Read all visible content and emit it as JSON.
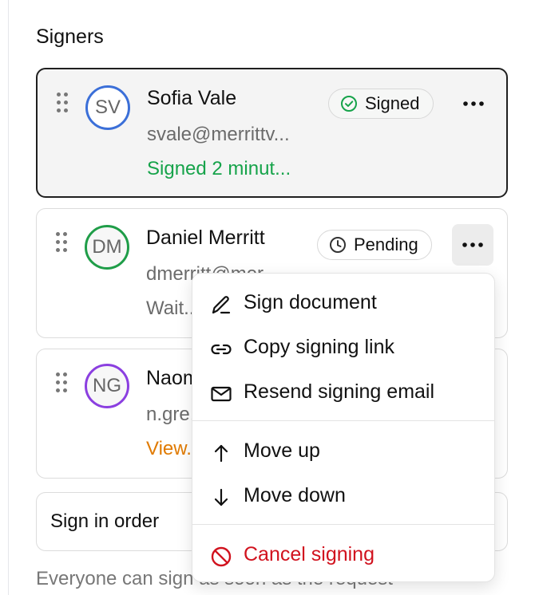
{
  "section_title": "Signers",
  "signers": [
    {
      "initials": "SV",
      "name": "Sofia Vale",
      "email": "svale@merrittv...",
      "status_text": "Signed 2 minut...",
      "badge": "Signed",
      "avatar_color": "#3b6fd8",
      "status_color": "#16a34a"
    },
    {
      "initials": "DM",
      "name": "Daniel Merritt",
      "email": "dmerritt@mer...",
      "status_text": "Wait...",
      "badge": "Pending",
      "avatar_color": "#1f9d48",
      "status_color": "#6b6b6b"
    },
    {
      "initials": "NG",
      "name": "Naomi...",
      "email": "n.gre...",
      "status_text": "View...",
      "avatar_color": "#8b3fe0",
      "status_color": "#e07a00"
    }
  ],
  "order_label": "Sign in order",
  "helper_text": "Everyone can sign as soon as the request",
  "menu": {
    "items": [
      {
        "label": "Sign document",
        "icon": "pencil-icon"
      },
      {
        "label": "Copy signing link",
        "icon": "link-icon"
      },
      {
        "label": "Resend signing email",
        "icon": "mail-icon"
      },
      {
        "label": "Move up",
        "icon": "arrow-up-icon"
      },
      {
        "label": "Move down",
        "icon": "arrow-down-icon"
      },
      {
        "label": "Cancel signing",
        "icon": "ban-icon"
      }
    ]
  },
  "colors": {
    "danger": "#d1121e",
    "signed_green": "#16a34a",
    "viewed_orange": "#e07a00"
  }
}
